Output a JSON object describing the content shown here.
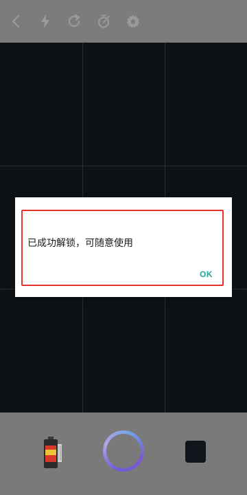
{
  "toolbar": {
    "icons": [
      "back-icon",
      "flash-icon",
      "refresh-icon",
      "timer-icon",
      "settings-icon"
    ],
    "icon_color": "#9a9a9a"
  },
  "viewfinder": {
    "background": "#0f1215",
    "grid": "3x3"
  },
  "dialog": {
    "message": "已成功解锁，可随意使用",
    "ok_label": "OK",
    "ok_color": "#1ea595",
    "highlight_color": "#e5322d"
  },
  "bottom": {
    "shutter_gradient": [
      "#6d5bd6",
      "#b6a3e8",
      "#6ea4e6"
    ]
  }
}
